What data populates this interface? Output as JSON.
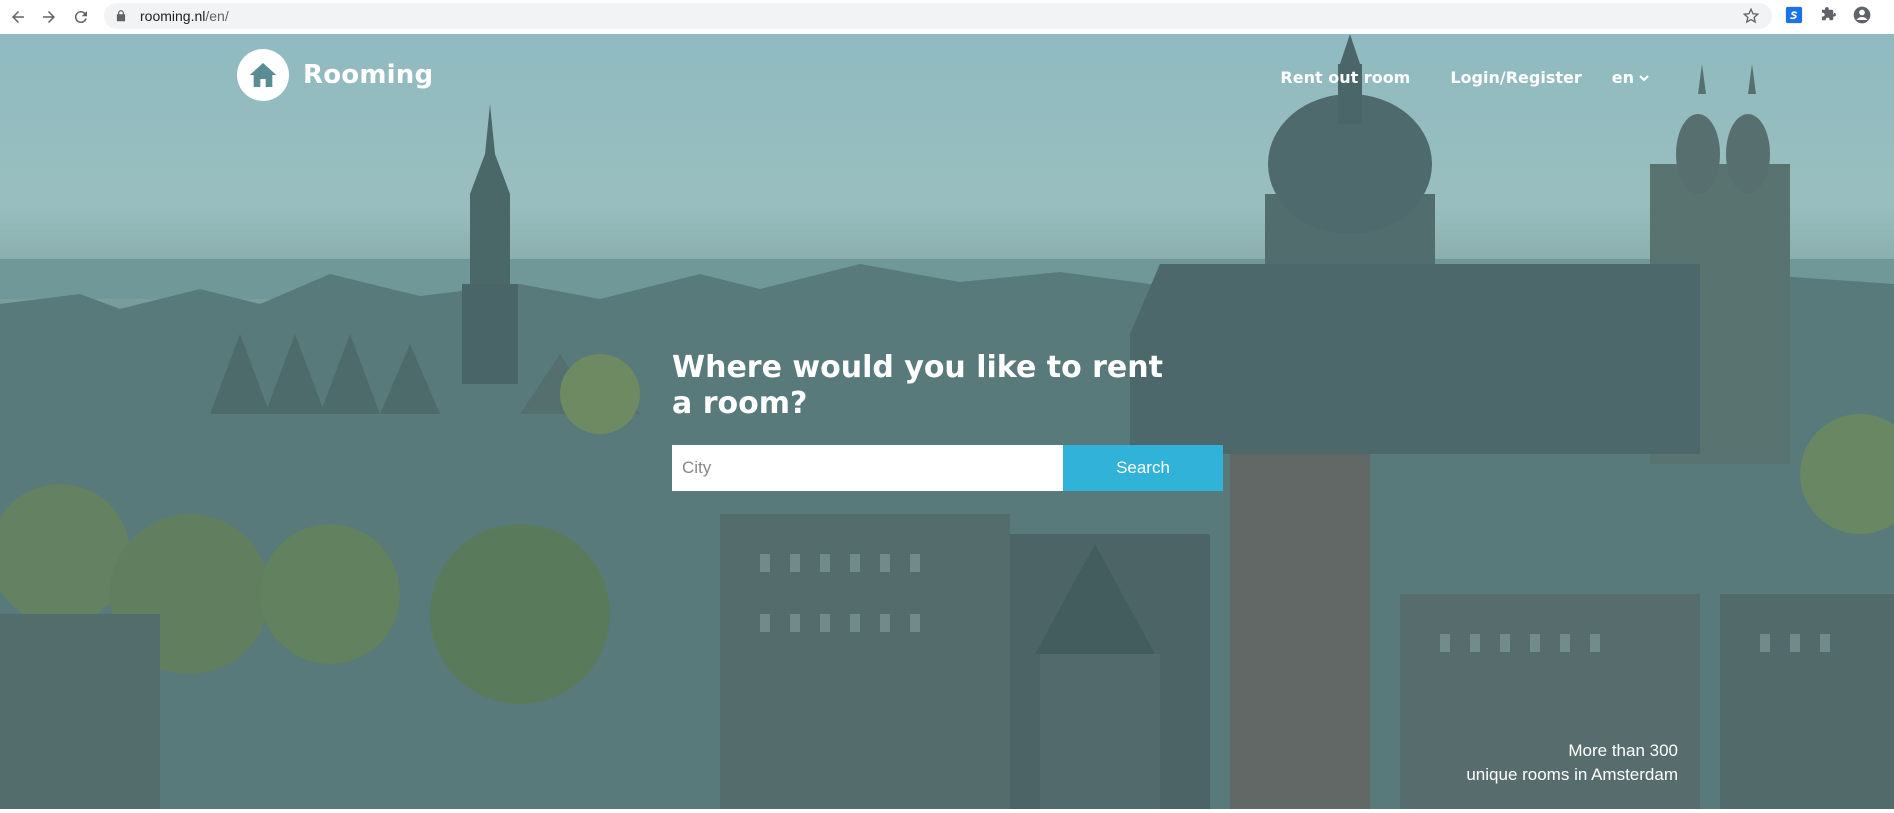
{
  "browser": {
    "url_host": "rooming.nl",
    "url_path": "/en/"
  },
  "header": {
    "brand": "Rooming",
    "nav": {
      "rent_out": "Rent out room",
      "login": "Login/Register",
      "language": "en"
    }
  },
  "hero": {
    "headline": "Where would you like to rent a room?",
    "search": {
      "placeholder": "City",
      "button": "Search"
    },
    "tagline_line1": "More than 300",
    "tagline_line2": "unique rooms in Amsterdam"
  },
  "colors": {
    "accent": "#31b2d8",
    "hero_tint": "#5a8c96"
  }
}
